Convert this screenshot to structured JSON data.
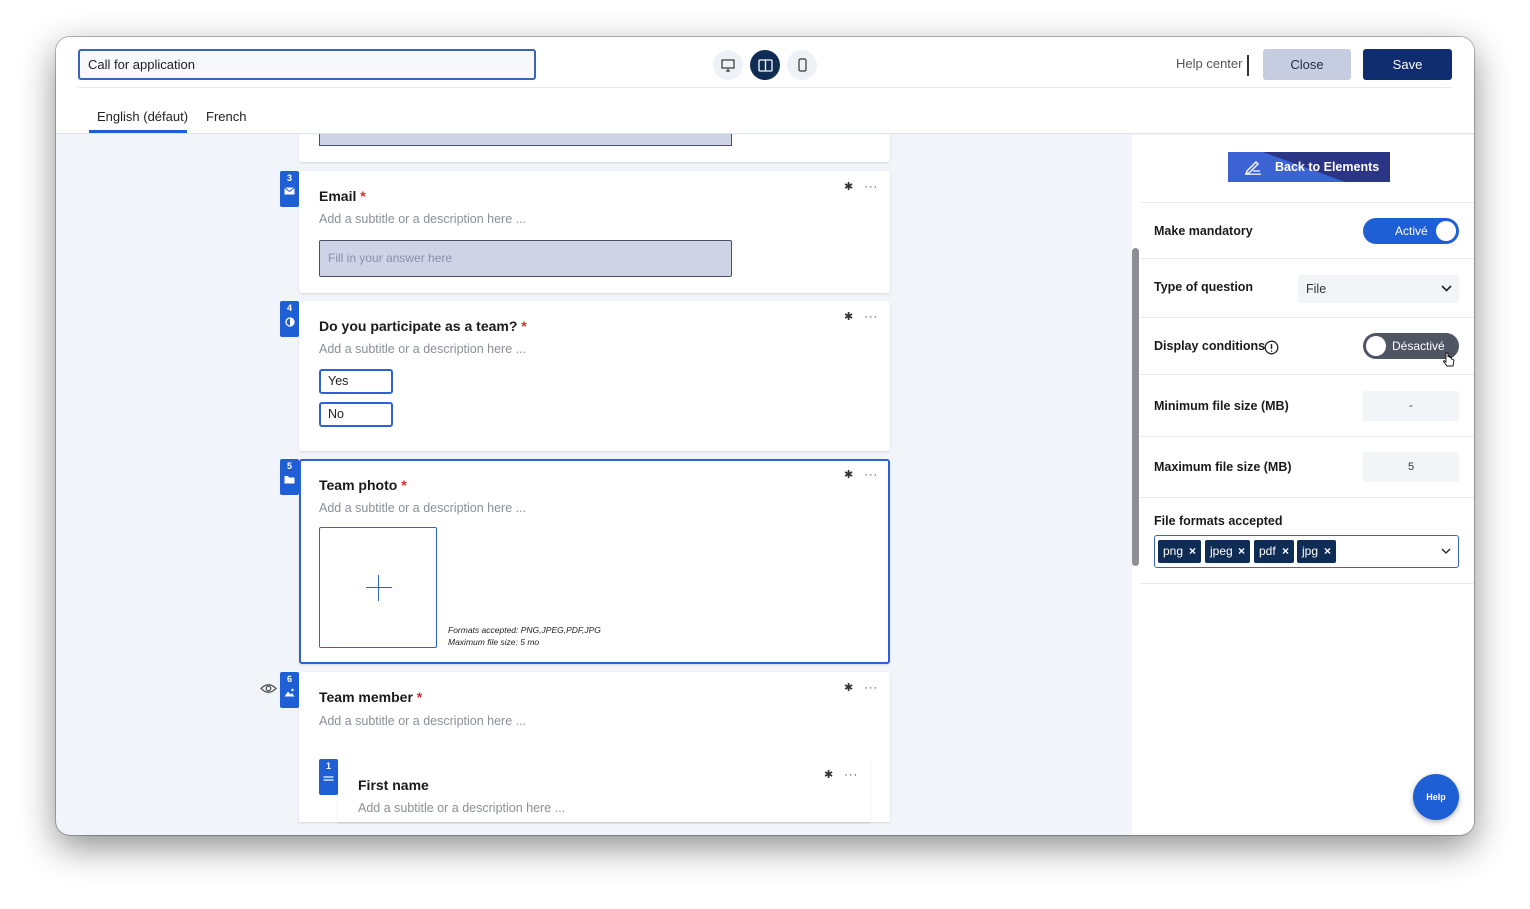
{
  "header": {
    "form_title": "Call for application",
    "help_center": "Help center",
    "close_label": "Close",
    "save_label": "Save",
    "view_modes": [
      "desktop-icon",
      "split-view-icon",
      "mobile-icon"
    ],
    "active_view": "split-view-icon"
  },
  "tabs": [
    {
      "label": "English (défaut)",
      "active": true
    },
    {
      "label": "French",
      "active": false
    }
  ],
  "questions": {
    "email": {
      "number": "3",
      "title": "Email",
      "subtitle": "Add a subtitle or a description here ...",
      "placeholder": "Fill in your answer here",
      "icon": "envelope-icon"
    },
    "team": {
      "number": "4",
      "title": "Do you participate as a team?",
      "subtitle": "Add a subtitle or a description here ...",
      "options": [
        "Yes",
        "No"
      ],
      "icon": "half-circle-icon"
    },
    "photo": {
      "number": "5",
      "title": "Team photo",
      "subtitle": "Add a subtitle or a description here ...",
      "formats_note": "Formats accepted: PNG,JPEG,PDF,JPG",
      "size_note": "Maximum file size: 5 mo",
      "icon": "folder-icon"
    },
    "member": {
      "number": "6",
      "title": "Team member",
      "subtitle": "Add a subtitle or a description here ...",
      "icon": "image-icon"
    },
    "firstname": {
      "number": "1",
      "title": "First name",
      "subtitle": "Add a subtitle or a description here ...",
      "icon": "short-text-icon"
    },
    "required_mark": "*"
  },
  "panel": {
    "back_label": "Back to Elements",
    "mandatory_label": "Make mandatory",
    "mandatory_state": "Activé",
    "type_label": "Type of question",
    "type_value": "File",
    "conditions_label": "Display conditions",
    "conditions_state": "Désactivé",
    "min_size_label": "Minimum file size (MB)",
    "min_size_value": "-",
    "max_size_label": "Maximum file size (MB)",
    "max_size_value": "5",
    "formats_label": "File formats accepted",
    "formats": [
      "png",
      "jpeg",
      "pdf",
      "jpg"
    ],
    "chip_remove": "×"
  },
  "help_button": "Help",
  "colors": {
    "primary": "#1f5fd6",
    "navy": "#0f2c55",
    "required": "#d92b2b"
  }
}
